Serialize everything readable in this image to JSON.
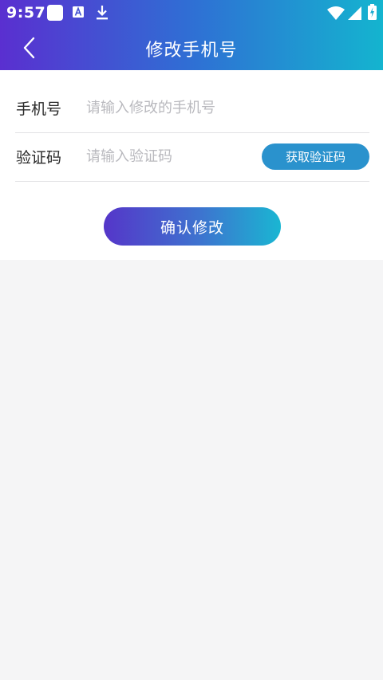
{
  "status_bar": {
    "time": "9:57",
    "icons": [
      "notification-square-icon",
      "text-a-icon",
      "download-icon",
      "wifi-icon",
      "signal-icon",
      "battery-charging-icon"
    ]
  },
  "nav": {
    "title": "修改手机号",
    "back_icon": "chevron-left-icon"
  },
  "form": {
    "phone": {
      "label": "手机号",
      "placeholder": "请输入修改的手机号",
      "value": ""
    },
    "code": {
      "label": "验证码",
      "placeholder": "请输入验证码",
      "value": "",
      "button_label": "获取验证码"
    },
    "submit_label": "确认修改"
  },
  "colors": {
    "header_gradient": [
      "#5a2fd0",
      "#14b4cf"
    ],
    "code_button": "#2a92cd",
    "page_background": "#f5f5f6"
  }
}
